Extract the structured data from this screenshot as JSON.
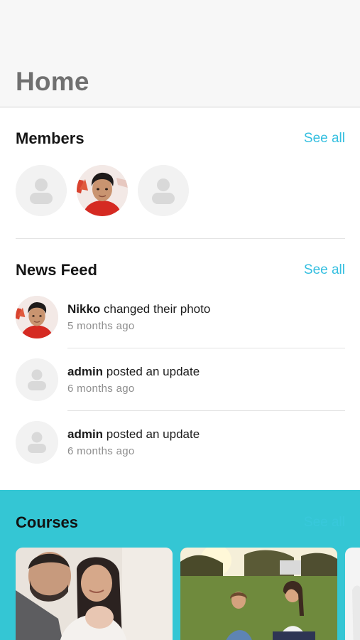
{
  "header": {
    "title": "Home"
  },
  "members": {
    "title": "Members",
    "see_all": "See all",
    "items": [
      {
        "kind": "placeholder"
      },
      {
        "kind": "photo"
      },
      {
        "kind": "placeholder"
      }
    ]
  },
  "news_feed": {
    "title": "News Feed",
    "see_all": "See all",
    "items": [
      {
        "actor": "Nikko",
        "action": " changed their photo",
        "time": "5 months ago"
      },
      {
        "actor": "admin",
        "action": " posted an update",
        "time": "6 months ago"
      },
      {
        "actor": "admin",
        "action": " posted an update",
        "time": "6 months ago"
      }
    ]
  },
  "courses": {
    "title": "Courses",
    "see_all": "See all"
  },
  "colors": {
    "accent": "#35bfe0",
    "courses_bg": "#34c6d4",
    "title_gray": "#707070"
  }
}
